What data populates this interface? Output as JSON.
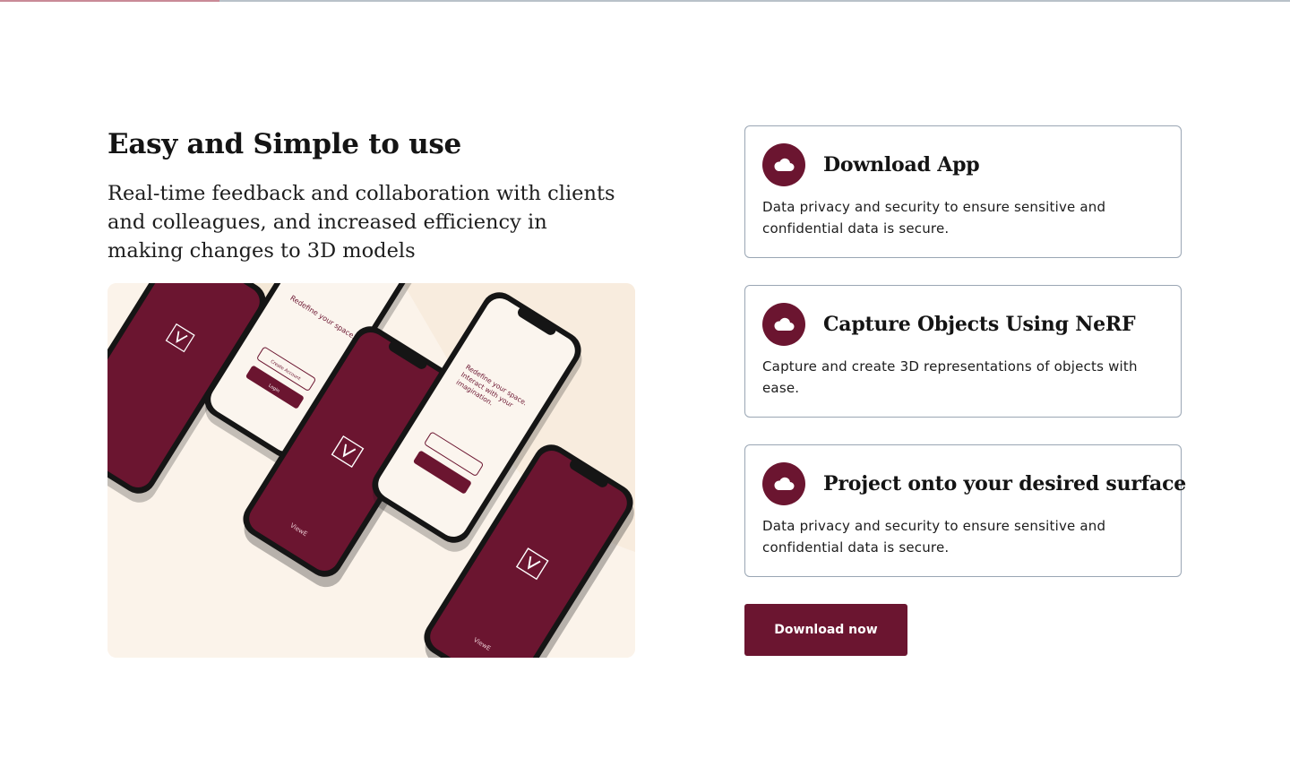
{
  "colors": {
    "brand": "#6b1530",
    "card_border": "#9aa6b4",
    "hero_bg": "#fbf3ea"
  },
  "intro": {
    "title": "Easy and Simple to use",
    "subtitle": "Real-time feedback and collaboration with clients and colleagues, and increased efficiency in making changes to 3D models"
  },
  "hero_image": {
    "phone_texts": {
      "tagline": "Redefine your space. Interact with your imagination.",
      "create_account": "Create Account",
      "login": "Login",
      "brand": "ViewE"
    }
  },
  "features": [
    {
      "icon": "cloud-icon",
      "title": "Download App",
      "description": "Data privacy and security to ensure sensitive and confidential data is secure."
    },
    {
      "icon": "cloud-icon",
      "title": "Capture Objects Using NeRF",
      "description": "Capture and create 3D representations of objects with ease."
    },
    {
      "icon": "cloud-icon",
      "title": "Project onto your desired surface",
      "description": "Data privacy and security to ensure sensitive and confidential data is secure."
    }
  ],
  "cta": {
    "label": "Download now"
  }
}
